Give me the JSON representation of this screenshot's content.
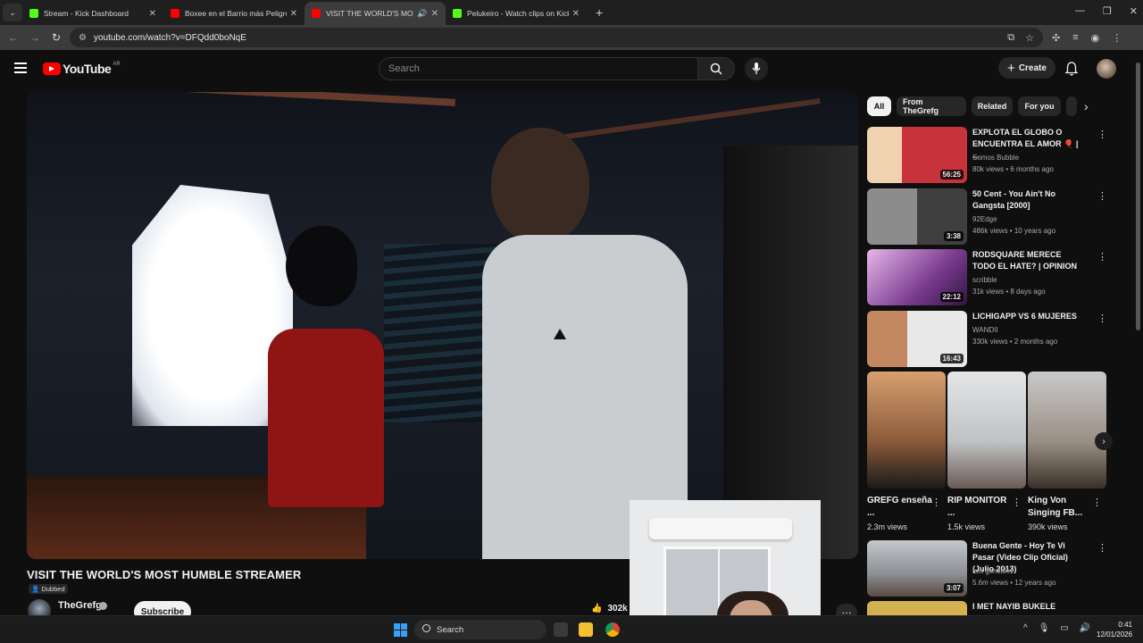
{
  "browser": {
    "tabs": [
      {
        "title": "Stream - Kick Dashboard",
        "favicon_color": "#53fc18",
        "active": false
      },
      {
        "title": "Boxee en el Barrio más Peligroso",
        "favicon_color": "#ff0000",
        "active": false
      },
      {
        "title": "VISIT THE WORLD'S MOST HUMBLE STREAMER",
        "favicon_color": "#ff0000",
        "active": true
      },
      {
        "title": "Pelukeiro - Watch clips on Kick",
        "favicon_color": "#53fc18",
        "active": false
      }
    ],
    "url": "youtube.com/watch?v=DFQdd0boNqE"
  },
  "youtube": {
    "logo_text": "YouTube",
    "country_code": "AR",
    "search_placeholder": "Search",
    "create_label": "Create"
  },
  "video": {
    "title": "VISIT THE WORLD'S MOST HUMBLE STREAMER",
    "dubbed_label": "Dubbed",
    "channel": "TheGrefg",
    "subscribe_label": "Subscribe",
    "likes": "302k"
  },
  "chips": [
    "All",
    "From TheGrefg",
    "Related",
    "For you"
  ],
  "recommendations": [
    {
      "title": "EXPLOTA EL GLOBO O ENCUENTRA EL AMOR 🎈 | ...",
      "channel": "Somos Bubble",
      "meta": "80k views • 6 months ago",
      "duration": "56:25",
      "thumb_color": "#c8323a"
    },
    {
      "title": "50 Cent - You Ain't No Gangsta [2000]",
      "channel": "92Edge",
      "meta": "486k views • 10 years ago",
      "duration": "3:38",
      "thumb_color": "#6d6d6d"
    },
    {
      "title": "RODSQUARE MERECE TODO EL HATE? | OPINION",
      "channel": "scribble",
      "meta": "31k views • 8 days ago",
      "duration": "22:12",
      "thumb_color": "#7a3b8f"
    },
    {
      "title": "LICHIGAPP VS 6 MUJERES",
      "channel": "WANDII",
      "meta": "330k views • 2 months ago",
      "duration": "16:43",
      "thumb_color": "#b8b8b8"
    },
    {
      "title": "Buena Gente - Hoy Te Vi Pasar (Video Clip Oficial) (Julio 2013)",
      "channel": "luis gonzalez",
      "meta": "5.6m views • 12 years ago",
      "duration": "3:07",
      "thumb_color": "#8c8f93"
    },
    {
      "title": "I MET NAYIB BUKELE",
      "channel": "",
      "meta": "",
      "duration": "",
      "thumb_color": "#d3b150"
    }
  ],
  "shorts": [
    {
      "title": "GREFG enseña ...",
      "views": "2.3m views",
      "thumb_color": "#d7a070"
    },
    {
      "title": "RIP MONITOR ...",
      "views": "1.5k views",
      "thumb_color": "#c9cbcc"
    },
    {
      "title": "King Von Singing FB...",
      "views": "390k views",
      "thumb_color": "#9a8f84"
    }
  ],
  "taskbar": {
    "search_label": "Search",
    "time": "0:41",
    "date": "12/01/2026"
  }
}
